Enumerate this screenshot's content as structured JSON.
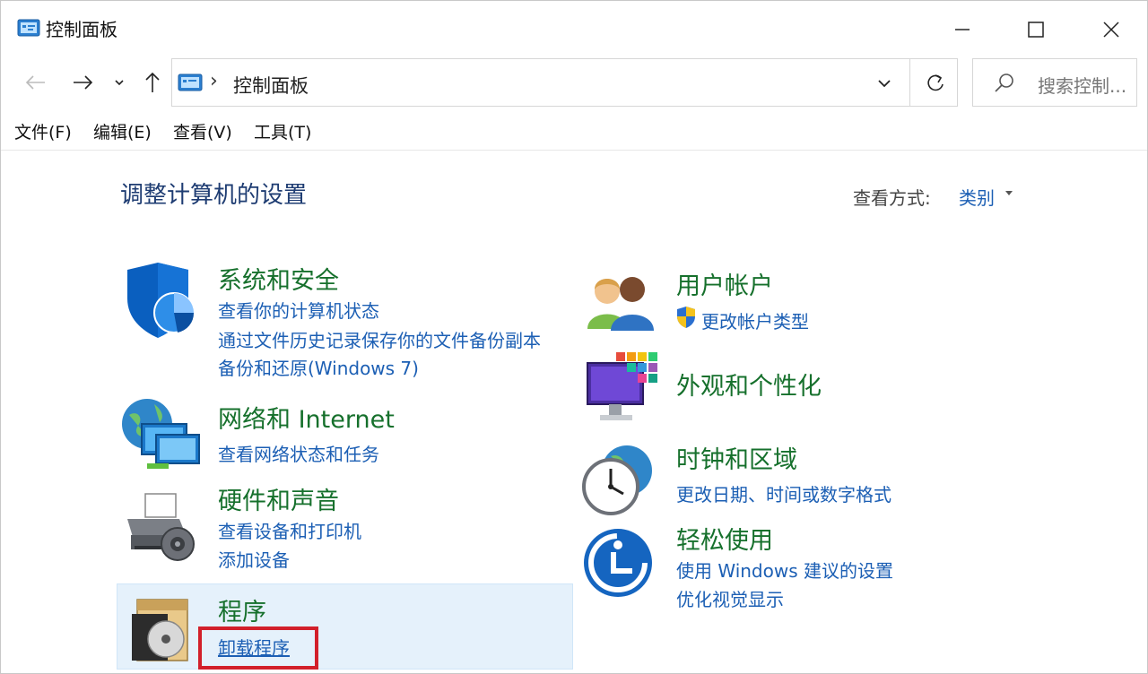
{
  "window": {
    "title": "控制面板",
    "controls": {
      "minimize": "minimize-icon",
      "maximize": "maximize-icon",
      "close": "close-icon"
    }
  },
  "nav": {
    "back_icon": "back-arrow-icon",
    "forward_icon": "forward-arrow-icon",
    "recent_icon": "chevron-down-icon",
    "up_icon": "up-arrow-icon",
    "breadcrumb_separator": "›",
    "address": "控制面板",
    "refresh_icon": "refresh-icon",
    "search_placeholder": "搜索控制..."
  },
  "menu": [
    {
      "label": "文件(F)"
    },
    {
      "label": "编辑(E)"
    },
    {
      "label": "查看(V)"
    },
    {
      "label": "工具(T)"
    }
  ],
  "main": {
    "title": "调整计算机的设置",
    "view_by_label": "查看方式:",
    "view_by_value": "类别"
  },
  "categories": {
    "system": {
      "title": "系统和安全",
      "links": [
        "查看你的计算机状态",
        "通过文件历史记录保存你的文件备份副本",
        "备份和还原(Windows 7)"
      ],
      "icon": "shield-icon"
    },
    "network": {
      "title": "网络和 Internet",
      "links": [
        "查看网络状态和任务"
      ],
      "icon": "network-globe-icon"
    },
    "hardware": {
      "title": "硬件和声音",
      "links": [
        "查看设备和打印机",
        "添加设备"
      ],
      "icon": "printer-icon"
    },
    "programs": {
      "title": "程序",
      "links": [
        "卸载程序"
      ],
      "icon": "programs-disc-icon"
    },
    "accounts": {
      "title": "用户帐户",
      "links": [
        "更改帐户类型"
      ],
      "icon": "users-icon",
      "link_icon": "uac-shield-icon"
    },
    "appearance": {
      "title": "外观和个性化",
      "links": [],
      "icon": "monitor-palette-icon"
    },
    "clock": {
      "title": "时钟和区域",
      "links": [
        "更改日期、时间或数字格式"
      ],
      "icon": "clock-globe-icon"
    },
    "ease": {
      "title": "轻松使用",
      "links": [
        "使用 Windows 建议的设置",
        "优化视觉显示"
      ],
      "icon": "ease-of-access-icon"
    }
  },
  "colors": {
    "category_title": "#16702c",
    "link": "#1c5fb4",
    "page_title": "#1e3c72",
    "highlight_bg": "#e5f1fb",
    "annotation_red": "#d21f2a"
  }
}
